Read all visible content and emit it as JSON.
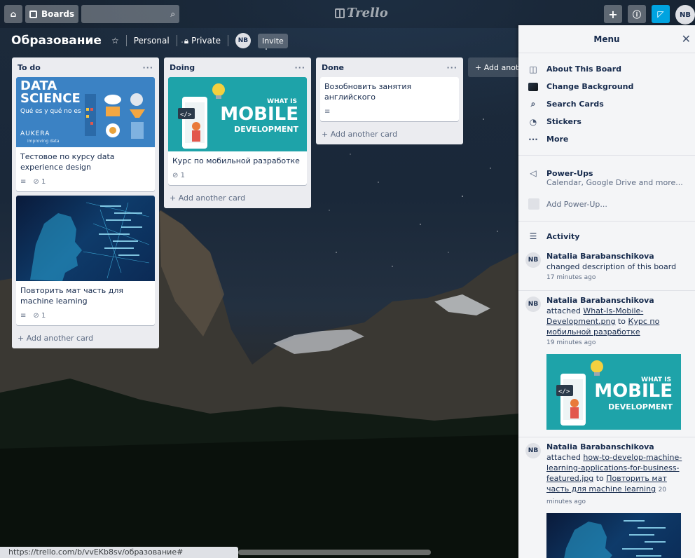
{
  "header": {
    "boards_label": "Boards",
    "logo": "Trello",
    "user_initials": "NB"
  },
  "board": {
    "title": "Образование",
    "visibility_team": "Personal",
    "visibility_privacy": "Private",
    "member_initials": "NB",
    "invite_label": "Invite"
  },
  "lists": [
    {
      "title": "To do",
      "cards": [
        {
          "cover_title_1": "DATA",
          "cover_title_2": "SCIENCE",
          "cover_sub": "Qué es y qué no es",
          "cover_brand": "AUKERA",
          "cover_brand_sub": "improving data",
          "title": "Тестовое по курсу data experience design",
          "attachments": "1"
        },
        {
          "title": "Повторить мат часть для machine learning",
          "attachments": "1"
        }
      ],
      "add_card": "+ Add another card"
    },
    {
      "title": "Doing",
      "cards": [
        {
          "cover_what": "WHAT IS",
          "cover_mobile": "MOBILE",
          "cover_dev": "DEVELOPMENT",
          "title": "Курс по мобильной разработке",
          "attachments": "1"
        }
      ],
      "add_card": "+ Add another card"
    },
    {
      "title": "Done",
      "cards": [
        {
          "title": "Возобновить занятия английского"
        }
      ],
      "add_card": "+ Add another card"
    }
  ],
  "add_list": "+ Add anoth",
  "menu": {
    "title": "Menu",
    "items": [
      {
        "label": "About This Board",
        "icon": "board-icon"
      },
      {
        "label": "Change Background",
        "icon": "background-swatch"
      },
      {
        "label": "Search Cards",
        "icon": "search-icon"
      },
      {
        "label": "Stickers",
        "icon": "sticker-icon"
      },
      {
        "label": "More",
        "icon": "more-icon"
      }
    ],
    "powerups_title": "Power-Ups",
    "powerups_sub": "Calendar, Google Drive and more...",
    "add_powerup": "Add Power-Up...",
    "activity_title": "Activity",
    "activities": [
      {
        "initials": "NB",
        "user": "Natalia Barabanschikova",
        "action": " changed description of this board",
        "time": "17 minutes ago"
      },
      {
        "initials": "NB",
        "user": "Natalia Barabanschikova",
        "action": " attached ",
        "link1": "What-Is-Mobile-Development.png",
        "mid": " to ",
        "link2": "Курс по мобильной разработке",
        "time": "19 minutes ago",
        "img_what": "WHAT IS",
        "img_mobile": "MOBILE",
        "img_dev": "DEVELOPMENT"
      },
      {
        "initials": "NB",
        "user": "Natalia Barabanschikova",
        "action": " attached ",
        "link1": "how-to-develop-machine-learning-applications-for-business-featured.jpg",
        "mid": " to ",
        "link2": "Повторить мат часть для machine learning",
        "time": "20 minutes ago"
      }
    ]
  },
  "status_url": "https://trello.com/b/vvEKb8sv/образование#"
}
